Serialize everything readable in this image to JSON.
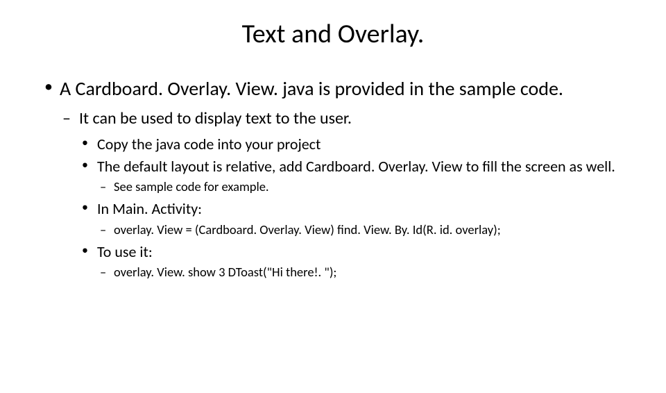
{
  "title": "Text and Overlay.",
  "b1": "A Cardboard. Overlay. View. java is provided in the sample code.",
  "b1_1": "It can be used to display text to the user.",
  "b1_1_1": "Copy the java code into your project",
  "b1_1_2": "The default layout is relative, add Cardboard. Overlay. View to fill the screen as well.",
  "b1_1_2_1": "See sample code for example.",
  "b1_1_3": "In Main. Activity:",
  "b1_1_3_1": "overlay. View = (Cardboard. Overlay. View) find. View. By. Id(R. id. overlay);",
  "b1_1_4": "To use it:",
  "b1_1_4_1": "overlay. View. show 3 DToast(\"Hi there!. \");"
}
